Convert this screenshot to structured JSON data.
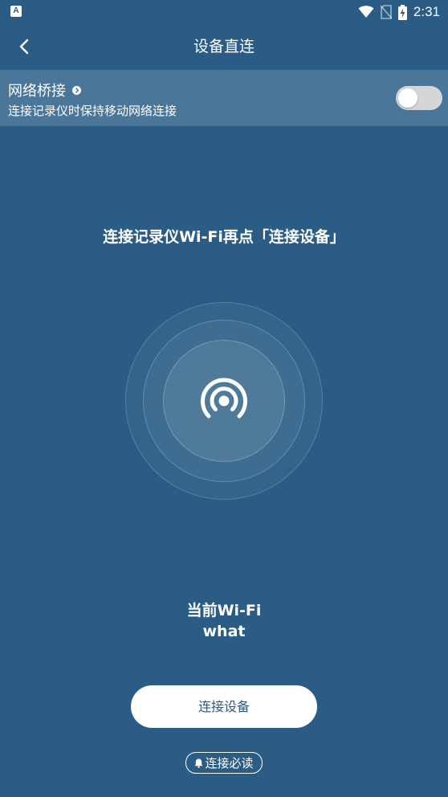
{
  "status_bar": {
    "app_badge": "A",
    "time": "2:31"
  },
  "nav": {
    "title": "设备直连"
  },
  "bridge": {
    "title": "网络桥接",
    "description": "连接记录仪时保持移动网络连接",
    "enabled": false
  },
  "instruction": "连接记录仪Wi-Fi再点「连接设备」",
  "wifi": {
    "label": "当前Wi-Fi",
    "name": "what"
  },
  "connect_button": {
    "label": "连接设备"
  },
  "must_read": {
    "label": "连接必读"
  },
  "colors": {
    "background": "#2a5c85",
    "bridge_row": "#4a7699",
    "toggle_off": "#d6d6d6",
    "button_text": "#2a5c85"
  }
}
